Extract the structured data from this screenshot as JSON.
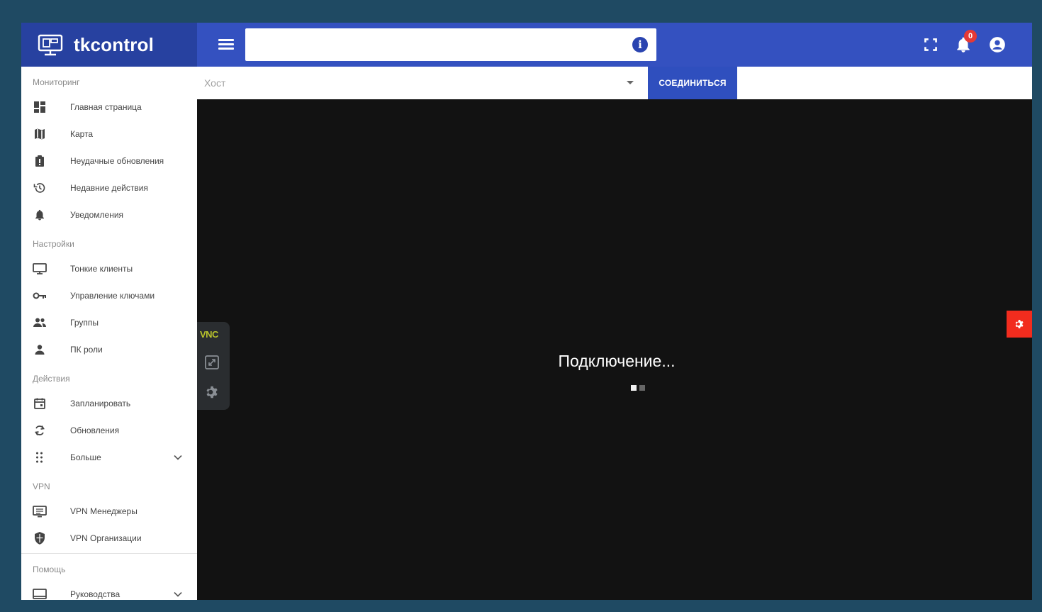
{
  "brand": {
    "name": "tkcontrol"
  },
  "search": {
    "value": "",
    "placeholder": ""
  },
  "notifications": {
    "count": "0"
  },
  "host": {
    "placeholder": "Хост"
  },
  "connect_label": "Соединиться",
  "viewer": {
    "status": "Подключение...",
    "vnc_logo": "VNC"
  },
  "sidebar": {
    "sections": [
      {
        "title": "Мониторинг",
        "items": [
          {
            "label": "Главная страница",
            "icon": "dashboard-icon"
          },
          {
            "label": "Карта",
            "icon": "map-icon"
          },
          {
            "label": "Неудачные обновления",
            "icon": "clipboard-icon"
          },
          {
            "label": "Недавние действия",
            "icon": "history-icon"
          },
          {
            "label": "Уведомления",
            "icon": "bell-icon"
          }
        ]
      },
      {
        "title": "Настройки",
        "items": [
          {
            "label": "Тонкие клиенты",
            "icon": "monitor-icon"
          },
          {
            "label": "Управление ключами",
            "icon": "key-icon"
          },
          {
            "label": "Группы",
            "icon": "group-icon"
          },
          {
            "label": "ПК роли",
            "icon": "person-icon"
          }
        ]
      },
      {
        "title": "Действия",
        "items": [
          {
            "label": "Запланировать",
            "icon": "calendar-icon"
          },
          {
            "label": "Обновления",
            "icon": "sync-icon"
          },
          {
            "label": "Больше",
            "icon": "apps-icon"
          }
        ]
      },
      {
        "title": "VPN",
        "items": [
          {
            "label": "VPN Менеджеры",
            "icon": "vpn-manager-icon"
          },
          {
            "label": "VPN Организации",
            "icon": "shield-icon"
          }
        ]
      },
      {
        "title": "Помощь",
        "items": [
          {
            "label": "Руководства",
            "icon": "book-icon"
          }
        ]
      }
    ]
  },
  "colors": {
    "brand": "#2741a0",
    "topbar": "#3451c0",
    "accent_button": "#2f4fbe",
    "viewer_bg": "#121212",
    "danger": "#f22c1e"
  }
}
